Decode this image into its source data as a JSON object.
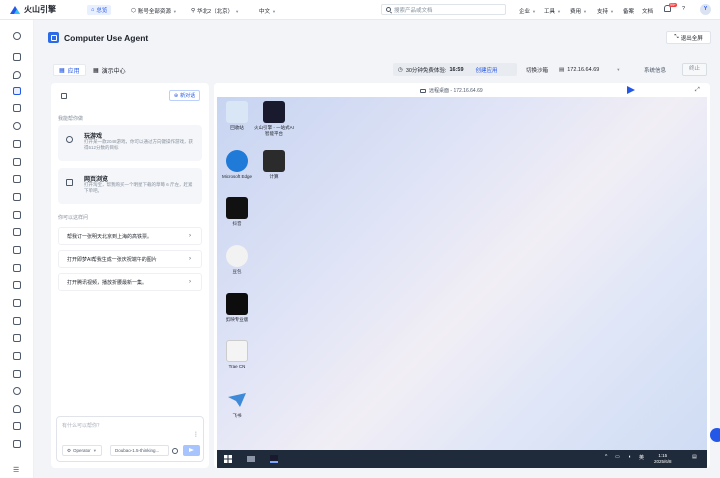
{
  "topbar": {
    "brand": "火山引擎",
    "home": "总览",
    "account_scope": "账号全部资源",
    "region": "华北2（北京）",
    "language": "中文",
    "search_placeholder": "搜索产品或文档",
    "menu": [
      "企业",
      "工具",
      "费用",
      "支持",
      "备案",
      "文档"
    ],
    "bell_badge": "99+",
    "avatar_initial": "Y"
  },
  "header": {
    "title": "Computer Use Agent",
    "exit_fullscreen": "退出全屏"
  },
  "tabs": [
    {
      "label": "应用",
      "active": true
    },
    {
      "label": "演示中心",
      "active": false
    }
  ],
  "toolbar": {
    "trial_label": "30分钟免费体验:",
    "trial_countdown": "16:59",
    "create_app": "创建应用",
    "switch_env": "切换沙箱",
    "ip": "172.16.64.69",
    "sys_info": "系统信息",
    "stop": "终止"
  },
  "chat": {
    "new_chat": "新对话",
    "help_label": "我能帮你做",
    "cards": [
      {
        "title": "玩游戏",
        "desc": "打开某一款2048游戏，你可以通过方向键操作游戏，获得512分数的目标",
        "icon": "location-pin-icon"
      },
      {
        "title": "网页浏览",
        "desc": "打开淘宝，帮我购买一个明星下载的草莓 6 斤左，赶紧下单吧。",
        "icon": "browser-icon"
      }
    ],
    "ask_label": "你可以这样问",
    "questions": [
      "帮我订一张明天北京到上海的高铁票。",
      "打开即梦AI帮我生成一张庆祝端午的图片",
      "打开腾讯视频，播放折腰最新一集。"
    ],
    "input_placeholder": "有什么可以帮你？",
    "agent_select": "Operator",
    "model_select": "Doubao-1.5-thinking..."
  },
  "remote": {
    "title": "远程桌面 - 172.16.64.69",
    "icons": [
      {
        "label": "回收站",
        "color": "#d8e6f6",
        "icon": "recycle-bin-icon"
      },
      {
        "label": "火山引擎 - 一站式AI智能平台",
        "color": "#1a1a2e",
        "icon": "volcengine-app-icon"
      },
      {
        "label": "Microsoft Edge",
        "color": "#1f7ad8",
        "icon": "edge-icon"
      },
      {
        "label": "计算",
        "color": "#2b2b2b",
        "icon": "calculator-icon"
      },
      {
        "label": "抖音",
        "color": "#111111",
        "icon": "douyin-icon"
      },
      {
        "label": "豆包",
        "color": "#f2f2f2",
        "icon": "doubao-icon"
      },
      {
        "label": "剪映专业版",
        "color": "#0d0d0d",
        "icon": "capcut-icon"
      },
      {
        "label": "Trae CN",
        "color": "#f4f4f4",
        "icon": "trae-icon"
      },
      {
        "label": "飞书",
        "color": "#3e8ad9",
        "icon": "feishu-icon"
      }
    ],
    "tray_lang": "英",
    "clock_time": "1:15",
    "clock_date": "2025/6/8"
  }
}
